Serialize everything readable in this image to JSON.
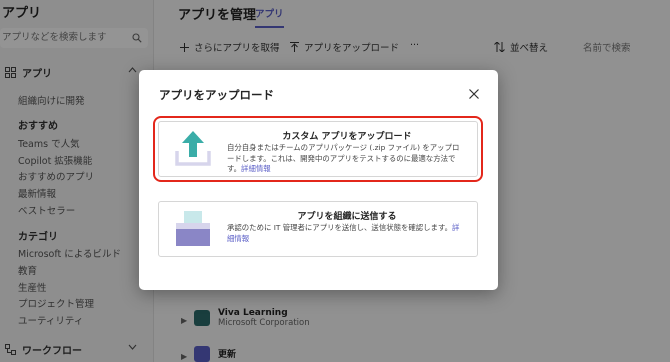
{
  "sidebar": {
    "title": "アプリ",
    "search_placeholder": "アプリなどを検索します",
    "section_apps": "アプリ",
    "items_top": [
      "組織向けに開発"
    ],
    "recommended_header": "おすすめ",
    "recommended": [
      "Teams で人気",
      "Copilot 拡張機能",
      "おすすめのアプリ",
      "最新情報",
      "ベストセラー"
    ],
    "category_header": "カテゴリ",
    "categories": [
      "Microsoft によるビルド",
      "教育",
      "生産性",
      "プロジェクト管理",
      "ユーティリティ"
    ],
    "section_workflow": "ワークフロー"
  },
  "main": {
    "title": "アプリを管理",
    "tab": "アプリ",
    "toolbar": {
      "get_more": "さらにアプリを取得",
      "upload": "アプリをアップロード",
      "more": "···",
      "sort": "並べ替え",
      "search_placeholder": "名前で検索"
    },
    "rows": [
      {
        "name": "Viva Learning",
        "publisher": "Microsoft Corporation"
      },
      {
        "name": "更新",
        "publisher": ""
      }
    ]
  },
  "dialog": {
    "title": "アプリをアップロード",
    "options": [
      {
        "title": "カスタム アプリをアップロード",
        "description": "自分自身またはチームのアプリパッケージ (.zip ファイル) をアップロードします。これは、開発中のアプリをテストするのに最適な方法です。",
        "link": "詳細情報"
      },
      {
        "title": "アプリを組織に送信する",
        "description": "承認のために IT 管理者にアプリを送信し、送信状態を確認します。",
        "link": "詳細情報"
      }
    ]
  },
  "colors": {
    "accent": "#5b5fc7",
    "upload_arrow": "#3aada8",
    "highlight": "#e3271b",
    "submit_icon_purple": "#8a86c6",
    "submit_icon_teal": "#c8e8ea"
  }
}
